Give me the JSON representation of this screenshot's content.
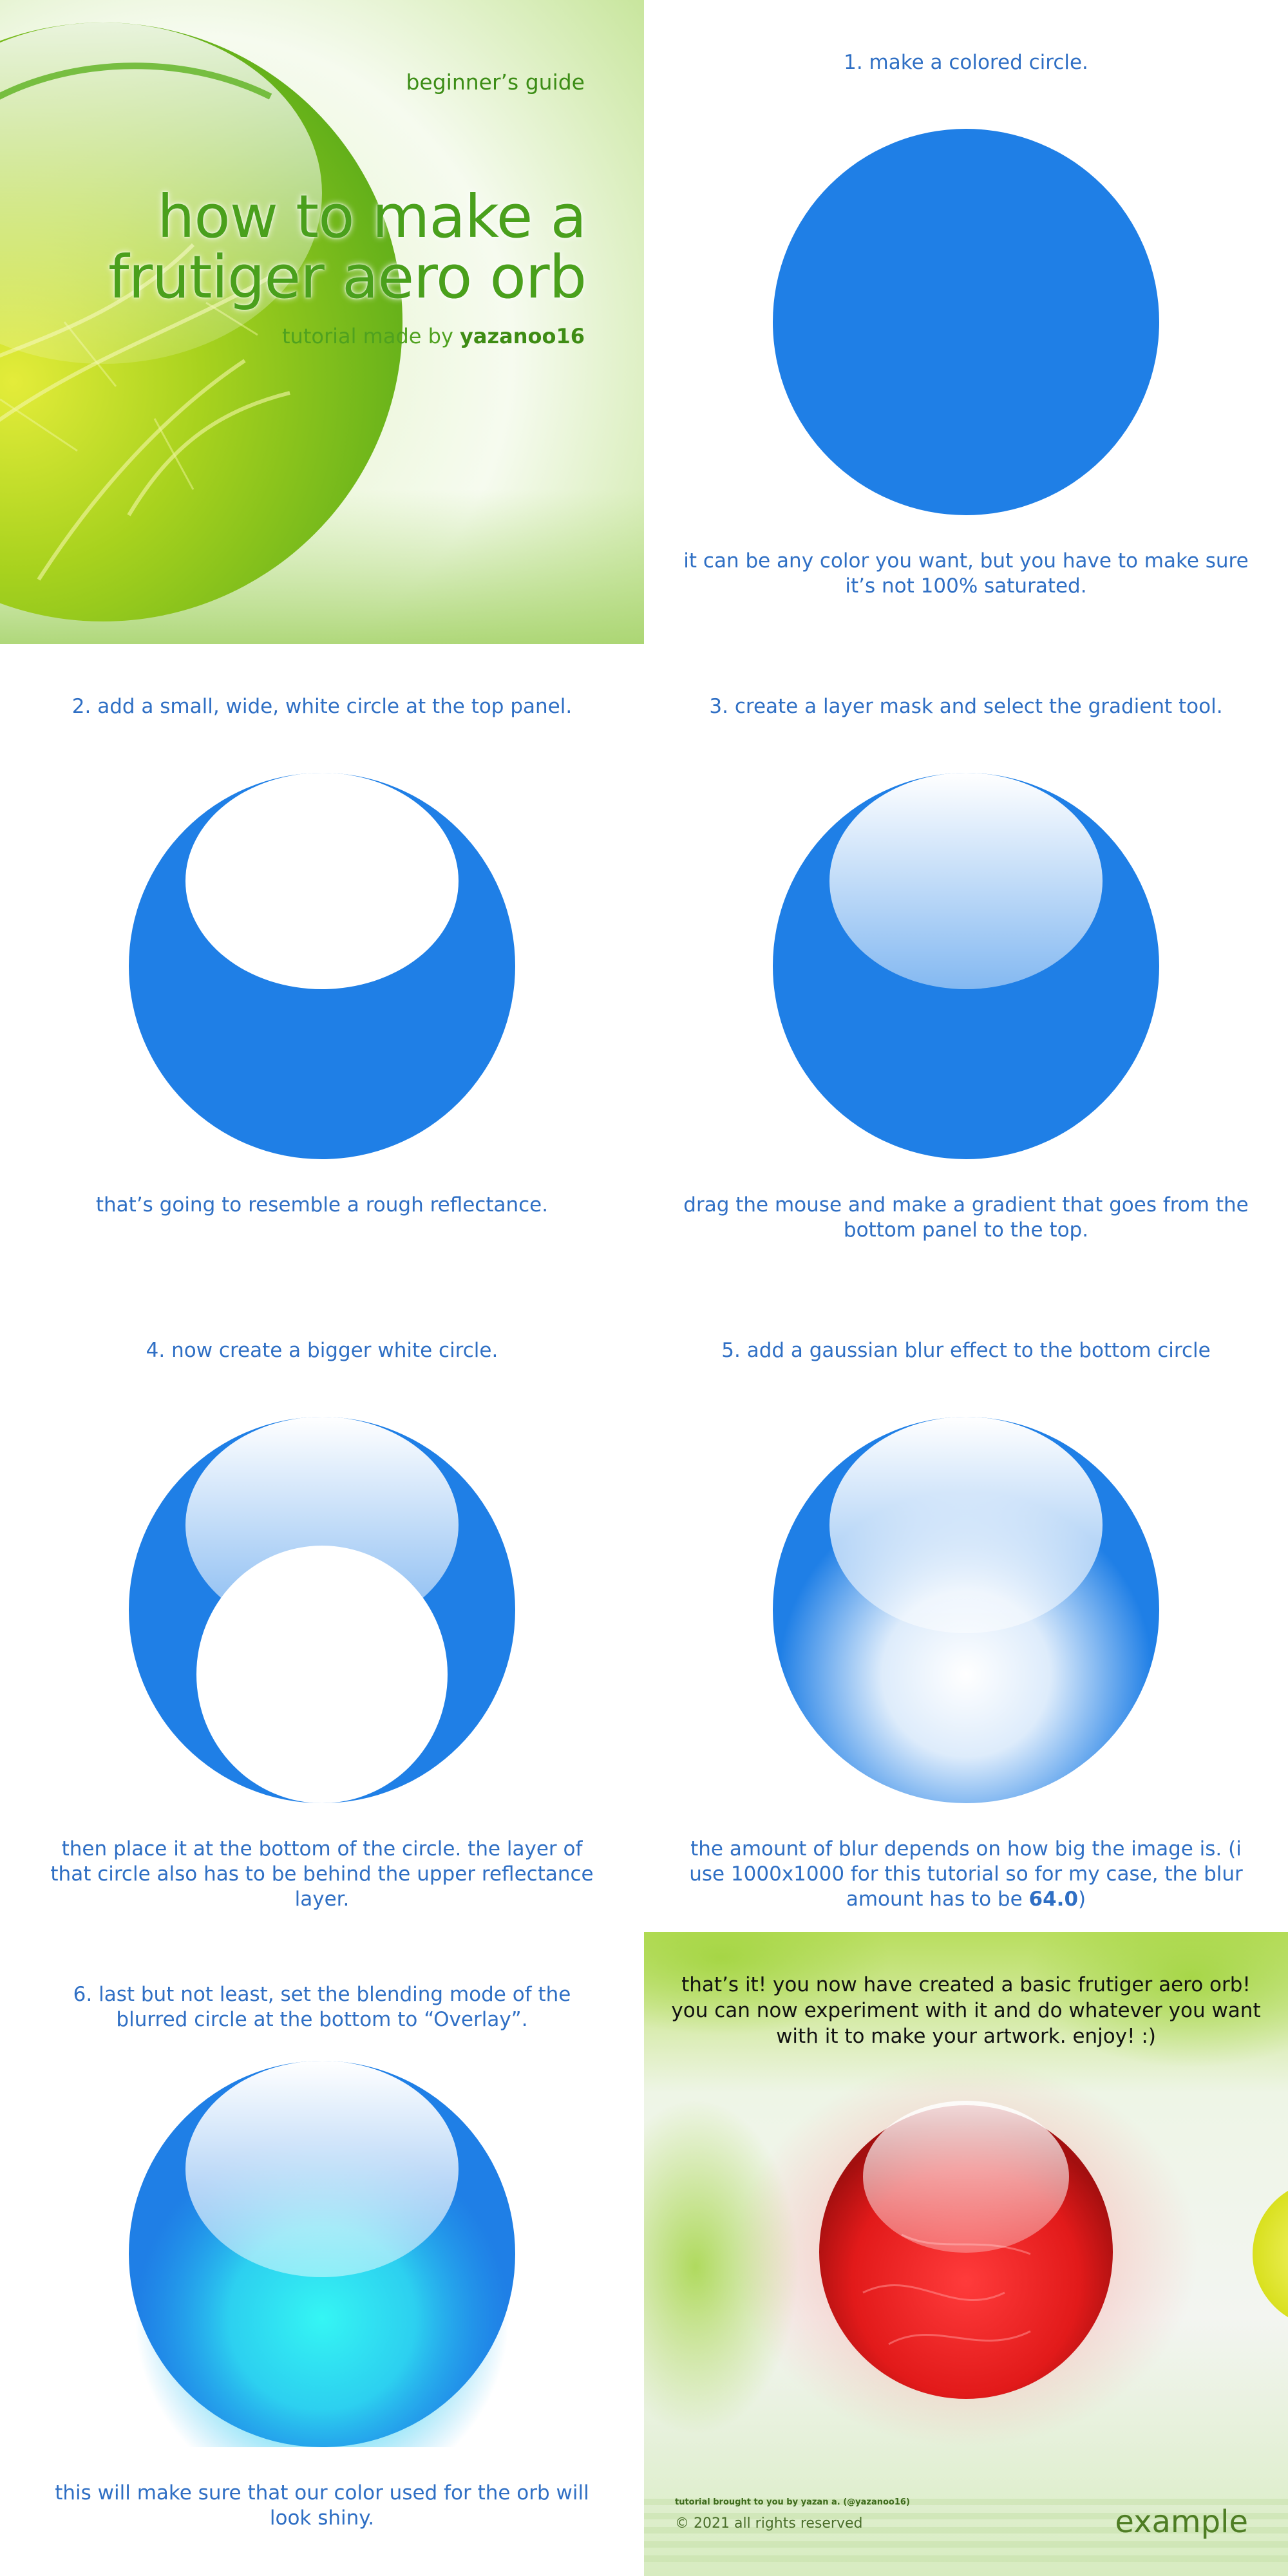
{
  "colors": {
    "caption_blue": "#2f6fc4",
    "orb_blue": "#1f7fe6",
    "title_green": "#4aa01c",
    "example_red": "#e21a1a"
  },
  "title_panel": {
    "kicker": "beginner’s guide",
    "title_line1": "how to make a",
    "title_line2": "frutiger aero orb",
    "credit_prefix": "tutorial made by",
    "credit_name": "yazanoo16"
  },
  "steps": [
    {
      "heading": "1. make a colored circle.",
      "note": "it can be any color you want, but you have to make sure it’s not 100% saturated."
    },
    {
      "heading": "2. add a small, wide, white circle at the top panel.",
      "note": "that’s going to resemble a rough reflectance."
    },
    {
      "heading": "3. create a layer mask and select the gradient tool.",
      "note": "drag the mouse and make a gradient that goes from the bottom panel to the top."
    },
    {
      "heading": "4. now create a bigger white circle.",
      "note": "then place it at the bottom of the circle. the layer of that circle also has to be behind the upper reflectance layer."
    },
    {
      "heading": "5. add a gaussian blur effect to the bottom circle",
      "note_prefix": "the amount of blur depends on how big the image is. (i use 1000x1000 for this tutorial so for my case, the blur amount has to be",
      "note_value": "64.0",
      "note_suffix": ")"
    },
    {
      "heading": "6. last but not least, set the blending mode of the blurred circle at the bottom to “Overlay”.",
      "note": "this will make sure that our color used for the orb will look shiny."
    }
  ],
  "example_panel": {
    "text": "that’s it! you now have created a basic frutiger aero orb! you can now experiment with it and do whatever you want with it to make your artwork.  enjoy! :)",
    "fine_print": "tutorial brought to you by yazan a. (@yazanoo16)",
    "copyright": "© 2021 all rights reserved",
    "label": "example"
  }
}
